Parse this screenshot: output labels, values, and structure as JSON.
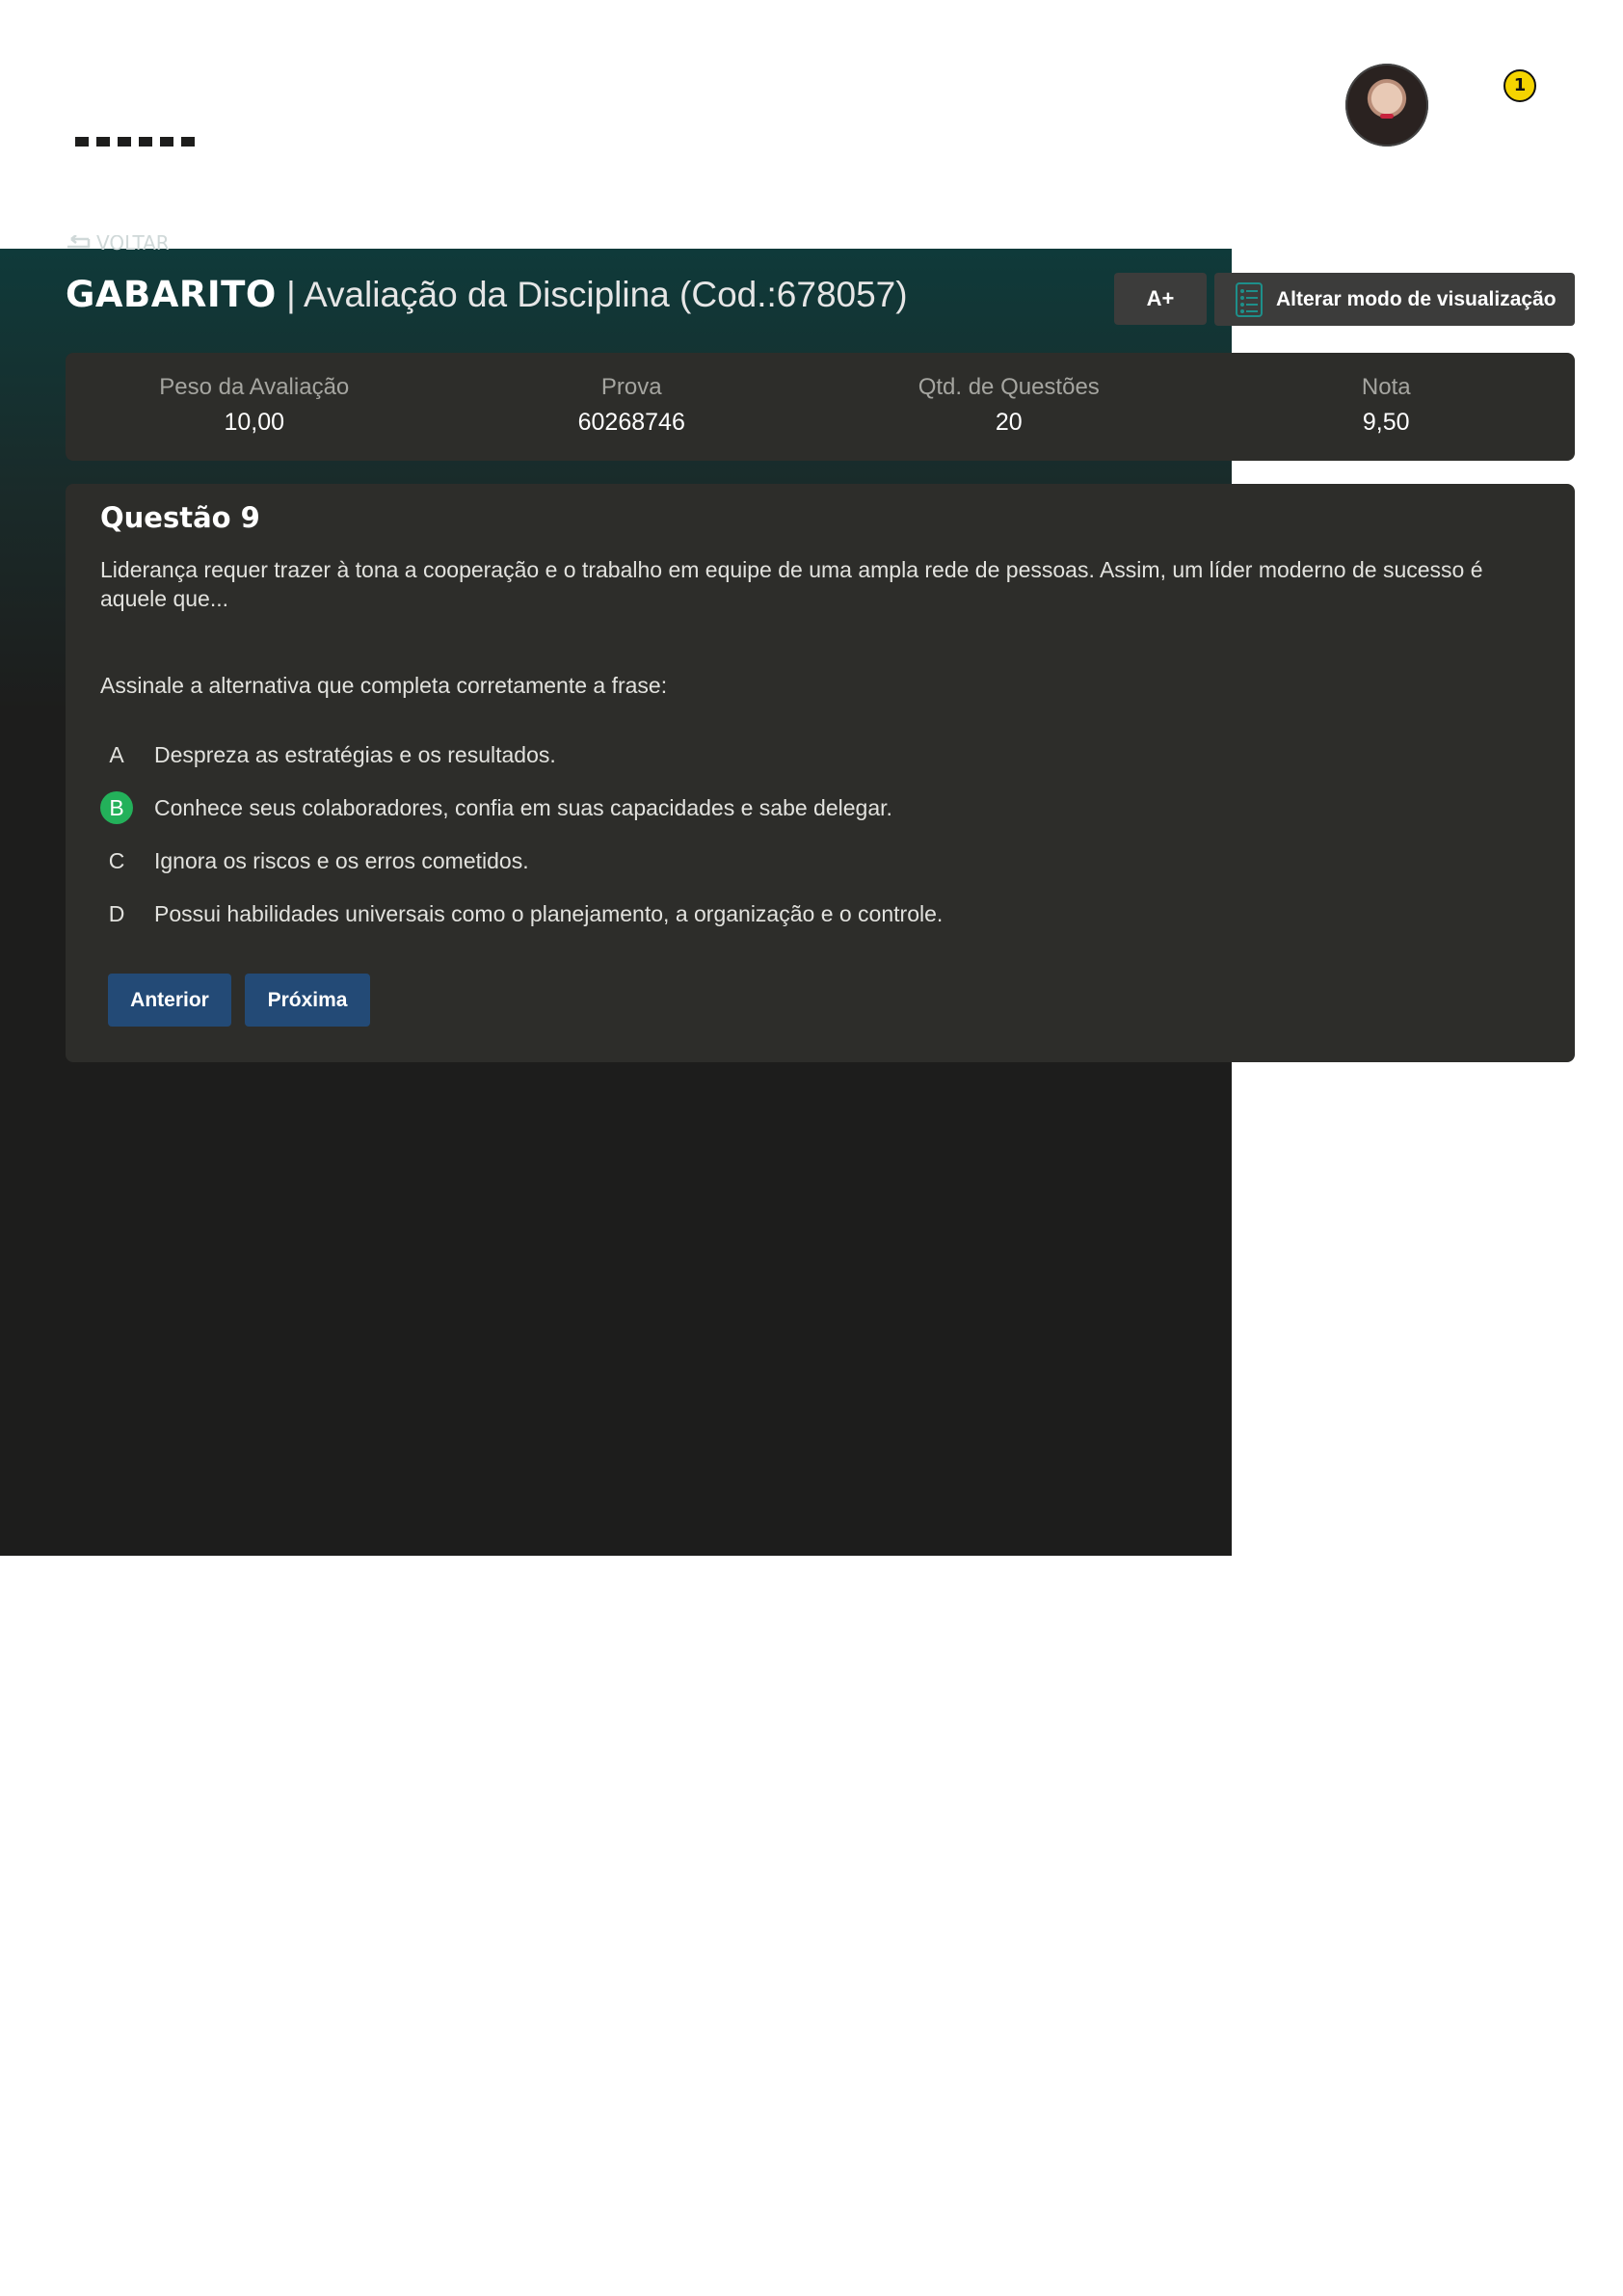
{
  "header": {
    "logo_icon": "book-logo",
    "avatar_icon": "user-avatar",
    "notification_count": "1"
  },
  "back": {
    "label": "VOLTAR",
    "icon": "return-arrow-icon"
  },
  "title": {
    "strong": "GABARITO",
    "separator": " | ",
    "rest": "Avaliação da Disciplina (Cod.:678057)"
  },
  "toolbar": {
    "font_increase_label": "A+",
    "view_mode_label": "Alterar modo de visualização",
    "view_mode_icon": "list-icon"
  },
  "summary": [
    {
      "label": "Peso da Avaliação",
      "value": "10,00"
    },
    {
      "label": "Prova",
      "value": "60268746"
    },
    {
      "label": "Qtd. de Questões",
      "value": "20"
    },
    {
      "label": "Nota",
      "value": "9,50"
    }
  ],
  "question": {
    "title": "Questão 9",
    "text": "Liderança requer trazer à tona a cooperação e o trabalho em equipe de uma ampla rede de pessoas. Assim, um líder moderno de sucesso é aquele que...",
    "instruction": "Assinale a alternativa que completa corretamente a frase:",
    "options": [
      {
        "letter": "A",
        "text": "Despreza as estratégias e os resultados.",
        "correct": false
      },
      {
        "letter": "B",
        "text": "Conhece seus colaboradores, confia em suas capacidades e sabe delegar.",
        "correct": true
      },
      {
        "letter": "C",
        "text": "Ignora os riscos e os erros cometidos.",
        "correct": false
      },
      {
        "letter": "D",
        "text": "Possui habilidades universais como o planejamento, a organização e o controle.",
        "correct": false
      }
    ],
    "prev_label": "Anterior",
    "next_label": "Próxima"
  },
  "colors": {
    "correct": "#23b15a",
    "nav_button": "#234a76",
    "card": "#2d2d2a",
    "badge": "#f5d400"
  }
}
